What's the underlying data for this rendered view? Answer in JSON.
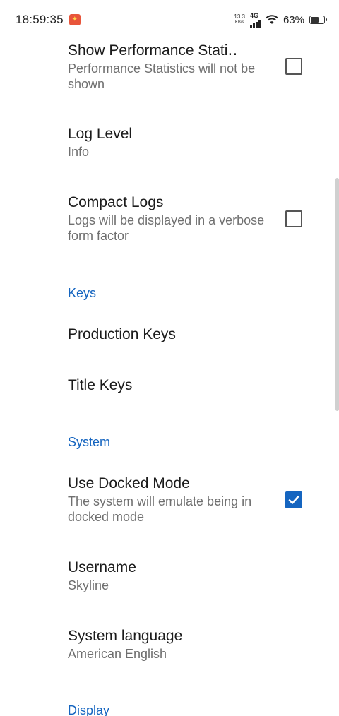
{
  "status_bar": {
    "time": "18:59:35",
    "net_speed_value": "13.3",
    "net_speed_unit": "KB/s",
    "net_type": "4G",
    "battery_pct": "63%",
    "battery_level": 0.63
  },
  "settings": {
    "perf_stats": {
      "title": "Show Performance Stati‥",
      "summary": "Performance Statistics will not be shown",
      "checked": false
    },
    "log_level": {
      "title": "Log Level",
      "summary": "Info"
    },
    "compact_logs": {
      "title": "Compact Logs",
      "summary": "Logs will be displayed in a verbose form factor",
      "checked": false
    },
    "keys_header": "Keys",
    "production_keys": {
      "title": "Production Keys"
    },
    "title_keys": {
      "title": "Title Keys"
    },
    "system_header": "System",
    "docked_mode": {
      "title": "Use Docked Mode",
      "summary": "The system will emulate being in docked mode",
      "checked": true
    },
    "username": {
      "title": "Username",
      "summary": "Skyline"
    },
    "system_language": {
      "title": "System language",
      "summary": "American English"
    },
    "display_header": "Display"
  },
  "colors": {
    "accent": "#1565c0",
    "summary_text": "#6f6f6f",
    "divider": "#d4d4d4"
  }
}
